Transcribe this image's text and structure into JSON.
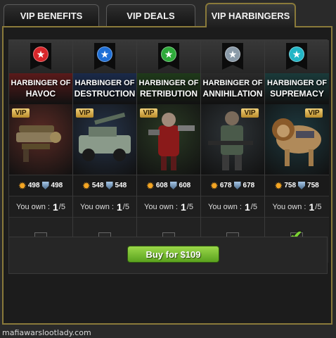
{
  "tabs": [
    {
      "label": "VIP BENEFITS"
    },
    {
      "label": "VIP DEALS"
    },
    {
      "label": "VIP HARBINGERS",
      "active": true
    }
  ],
  "harbingers": [
    {
      "line1": "HARBINGER OF",
      "line2": "HAVOC",
      "attack": "498",
      "defense": "498",
      "own_label": "You own :",
      "own_count": "1",
      "own_total": "/5",
      "checked": false,
      "vip": "VIP",
      "star_color": "#d9262a",
      "banner_color": "#5a1a1a",
      "art_color": "#5a2a24",
      "icon": "gatling-gun-icon"
    },
    {
      "line1": "HARBINGER OF",
      "line2": "DESTRUCTION",
      "attack": "548",
      "defense": "548",
      "own_label": "You own :",
      "own_count": "1",
      "own_total": "/5",
      "checked": false,
      "vip": "VIP",
      "star_color": "#1f6fd6",
      "banner_color": "#1a2a4a",
      "art_color": "#26344a",
      "icon": "armored-truck-icon"
    },
    {
      "line1": "HARBINGER OF",
      "line2": "RETRIBUTION",
      "attack": "608",
      "defense": "608",
      "own_label": "You own :",
      "own_count": "1",
      "own_total": "/5",
      "checked": false,
      "vip": "VIP",
      "star_color": "#2eaa3a",
      "banner_color": "#1f3a1a",
      "art_color": "#2a3a24",
      "icon": "armored-soldier-icon"
    },
    {
      "line1": "HARBINGER OF",
      "line2": "ANNIHILATION",
      "attack": "678",
      "defense": "678",
      "own_label": "You own :",
      "own_count": "1",
      "own_total": "/5",
      "checked": false,
      "vip": "VIP",
      "star_color": "#8a9aa8",
      "banner_color": "#2a2a2a",
      "art_color": "#2e3438",
      "icon": "commando-icon"
    },
    {
      "line1": "HARBINGER OF",
      "line2": "SUPREMACY",
      "attack": "758",
      "defense": "758",
      "own_label": "You own :",
      "own_count": "1",
      "own_total": "/5",
      "checked": true,
      "vip": "VIP",
      "star_color": "#22b6c6",
      "banner_color": "#1a3a3a",
      "art_color": "#1e3a40",
      "icon": "lion-icon"
    }
  ],
  "buy_button": {
    "label": "Buy for $109"
  },
  "watermark": "mafiawarslootlady.com"
}
